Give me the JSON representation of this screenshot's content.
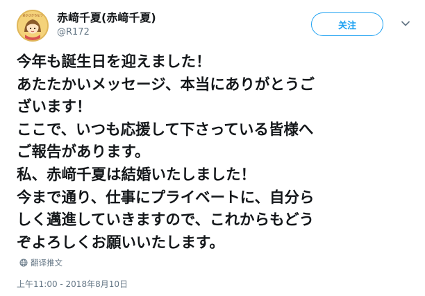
{
  "header": {
    "display_name": "赤﨑千夏(赤﨑千夏)",
    "handle": "@R172",
    "follow_label": "关注",
    "avatar_text": "あかさきちなつ"
  },
  "tweet": {
    "lines": [
      "今年も誕生日を迎えました！",
      "あたたかいメッセージ、本当にありがとうご",
      "ざいます！",
      "ここで、いつも応援して下さっている皆様へ",
      "ご報告があります。",
      "私、赤﨑千夏は結婚いたしました！",
      "今まで通り、仕事にプライベートに、自分ら",
      "しく邁進していきますので、これからもどう",
      "ぞよろしくお願いいたします。"
    ]
  },
  "translate_label": "翻译推文",
  "timestamp": "上午11:00 - 2018年8月10日",
  "icons": {
    "avatar": "avatar-illustration",
    "caret": "chevron-down-icon",
    "translate": "globe-icon"
  },
  "colors": {
    "accent": "#1da1f2",
    "text": "#14171a",
    "muted": "#657786",
    "avatar_bg": "#f4d27a"
  }
}
